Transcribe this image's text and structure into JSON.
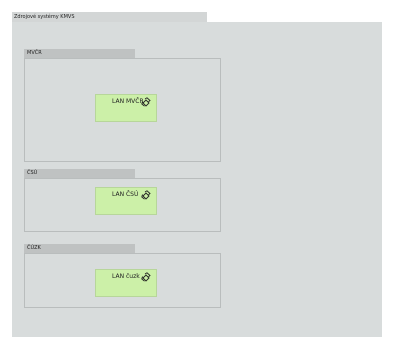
{
  "window": {
    "title": "Zdrojové systémy KMVS"
  },
  "groups": [
    {
      "title": "MVČR",
      "lan_label": "LAN MVČR",
      "icon": "network-link-icon"
    },
    {
      "title": "ČSÚ",
      "lan_label": "LAN ČSÚ",
      "icon": "network-link-icon"
    },
    {
      "title": "ČÚZK",
      "lan_label": "LAN čuzk",
      "icon": "network-link-icon"
    }
  ],
  "colors": {
    "canvas": "#d8dcdc",
    "lan_fill": "#ccf0a8",
    "group_bar": "#bfc2c2"
  }
}
